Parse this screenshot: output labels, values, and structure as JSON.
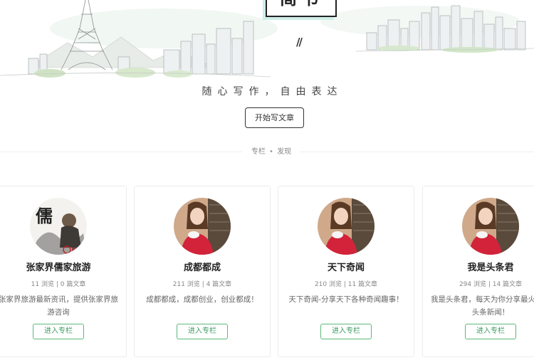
{
  "hero": {
    "logo_text": "简书",
    "slashes": "//",
    "tagline": "随心写作，自由表达",
    "write_button": "开始写文章"
  },
  "section": {
    "left": "专栏",
    "dot": "•",
    "right": "发现"
  },
  "columns": [
    {
      "name": "张家界儒家旅游",
      "stats": "11 浏览 | 0 篇文章",
      "desc": "张家界旅游最新资讯，提供张家界旅游咨询",
      "button": "进入专栏",
      "avatar": "calligraphy-logo"
    },
    {
      "name": "成都都成",
      "stats": "211 浏览 | 4 篇文章",
      "desc": "成都都成，成都创业，创业都成！",
      "button": "进入专栏",
      "avatar": "woman-photo"
    },
    {
      "name": "天下奇闻",
      "stats": "210 浏览 | 11 篇文章",
      "desc": "天下奇闻-分享天下各种奇闻趣事！",
      "button": "进入专栏",
      "avatar": "woman-photo"
    },
    {
      "name": "我是头条君",
      "stats": "294 浏览 | 14 篇文章",
      "desc": "我是头条君，每天为你分享最火爆的头条新闻！",
      "button": "进入专栏",
      "avatar": "woman-photo"
    }
  ],
  "colors": {
    "accent_green": "#3d9d61",
    "border": "#ececec",
    "logo_shadow": "#cfeee9"
  }
}
